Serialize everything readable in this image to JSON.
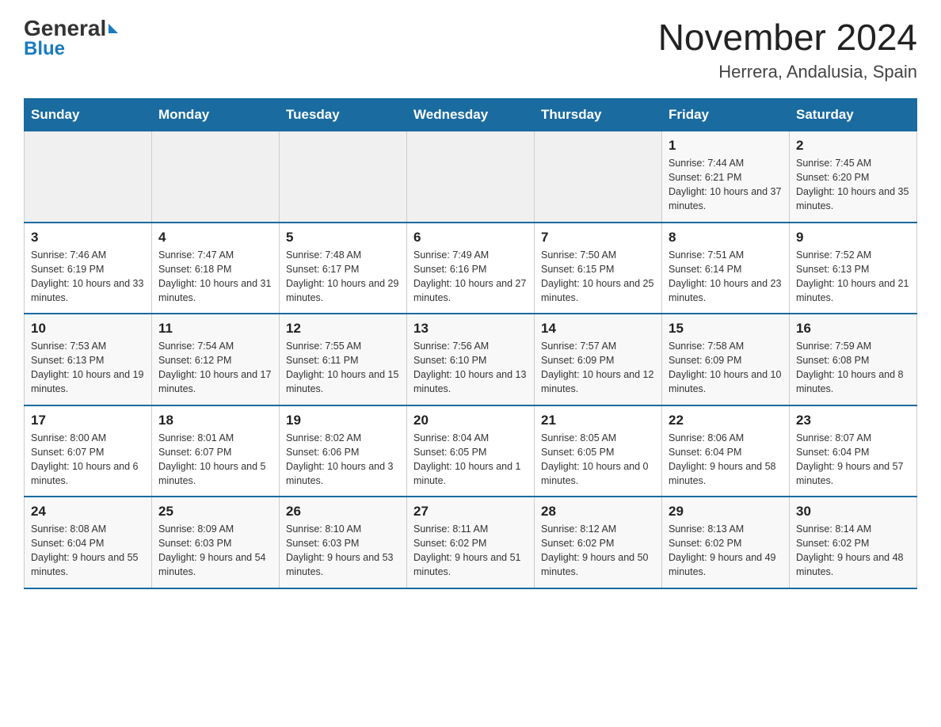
{
  "header": {
    "logo_general": "General",
    "logo_blue": "Blue",
    "month_year": "November 2024",
    "location": "Herrera, Andalusia, Spain"
  },
  "weekdays": [
    "Sunday",
    "Monday",
    "Tuesday",
    "Wednesday",
    "Thursday",
    "Friday",
    "Saturday"
  ],
  "weeks": [
    [
      {
        "day": "",
        "info": ""
      },
      {
        "day": "",
        "info": ""
      },
      {
        "day": "",
        "info": ""
      },
      {
        "day": "",
        "info": ""
      },
      {
        "day": "",
        "info": ""
      },
      {
        "day": "1",
        "info": "Sunrise: 7:44 AM\nSunset: 6:21 PM\nDaylight: 10 hours and 37 minutes."
      },
      {
        "day": "2",
        "info": "Sunrise: 7:45 AM\nSunset: 6:20 PM\nDaylight: 10 hours and 35 minutes."
      }
    ],
    [
      {
        "day": "3",
        "info": "Sunrise: 7:46 AM\nSunset: 6:19 PM\nDaylight: 10 hours and 33 minutes."
      },
      {
        "day": "4",
        "info": "Sunrise: 7:47 AM\nSunset: 6:18 PM\nDaylight: 10 hours and 31 minutes."
      },
      {
        "day": "5",
        "info": "Sunrise: 7:48 AM\nSunset: 6:17 PM\nDaylight: 10 hours and 29 minutes."
      },
      {
        "day": "6",
        "info": "Sunrise: 7:49 AM\nSunset: 6:16 PM\nDaylight: 10 hours and 27 minutes."
      },
      {
        "day": "7",
        "info": "Sunrise: 7:50 AM\nSunset: 6:15 PM\nDaylight: 10 hours and 25 minutes."
      },
      {
        "day": "8",
        "info": "Sunrise: 7:51 AM\nSunset: 6:14 PM\nDaylight: 10 hours and 23 minutes."
      },
      {
        "day": "9",
        "info": "Sunrise: 7:52 AM\nSunset: 6:13 PM\nDaylight: 10 hours and 21 minutes."
      }
    ],
    [
      {
        "day": "10",
        "info": "Sunrise: 7:53 AM\nSunset: 6:13 PM\nDaylight: 10 hours and 19 minutes."
      },
      {
        "day": "11",
        "info": "Sunrise: 7:54 AM\nSunset: 6:12 PM\nDaylight: 10 hours and 17 minutes."
      },
      {
        "day": "12",
        "info": "Sunrise: 7:55 AM\nSunset: 6:11 PM\nDaylight: 10 hours and 15 minutes."
      },
      {
        "day": "13",
        "info": "Sunrise: 7:56 AM\nSunset: 6:10 PM\nDaylight: 10 hours and 13 minutes."
      },
      {
        "day": "14",
        "info": "Sunrise: 7:57 AM\nSunset: 6:09 PM\nDaylight: 10 hours and 12 minutes."
      },
      {
        "day": "15",
        "info": "Sunrise: 7:58 AM\nSunset: 6:09 PM\nDaylight: 10 hours and 10 minutes."
      },
      {
        "day": "16",
        "info": "Sunrise: 7:59 AM\nSunset: 6:08 PM\nDaylight: 10 hours and 8 minutes."
      }
    ],
    [
      {
        "day": "17",
        "info": "Sunrise: 8:00 AM\nSunset: 6:07 PM\nDaylight: 10 hours and 6 minutes."
      },
      {
        "day": "18",
        "info": "Sunrise: 8:01 AM\nSunset: 6:07 PM\nDaylight: 10 hours and 5 minutes."
      },
      {
        "day": "19",
        "info": "Sunrise: 8:02 AM\nSunset: 6:06 PM\nDaylight: 10 hours and 3 minutes."
      },
      {
        "day": "20",
        "info": "Sunrise: 8:04 AM\nSunset: 6:05 PM\nDaylight: 10 hours and 1 minute."
      },
      {
        "day": "21",
        "info": "Sunrise: 8:05 AM\nSunset: 6:05 PM\nDaylight: 10 hours and 0 minutes."
      },
      {
        "day": "22",
        "info": "Sunrise: 8:06 AM\nSunset: 6:04 PM\nDaylight: 9 hours and 58 minutes."
      },
      {
        "day": "23",
        "info": "Sunrise: 8:07 AM\nSunset: 6:04 PM\nDaylight: 9 hours and 57 minutes."
      }
    ],
    [
      {
        "day": "24",
        "info": "Sunrise: 8:08 AM\nSunset: 6:04 PM\nDaylight: 9 hours and 55 minutes."
      },
      {
        "day": "25",
        "info": "Sunrise: 8:09 AM\nSunset: 6:03 PM\nDaylight: 9 hours and 54 minutes."
      },
      {
        "day": "26",
        "info": "Sunrise: 8:10 AM\nSunset: 6:03 PM\nDaylight: 9 hours and 53 minutes."
      },
      {
        "day": "27",
        "info": "Sunrise: 8:11 AM\nSunset: 6:02 PM\nDaylight: 9 hours and 51 minutes."
      },
      {
        "day": "28",
        "info": "Sunrise: 8:12 AM\nSunset: 6:02 PM\nDaylight: 9 hours and 50 minutes."
      },
      {
        "day": "29",
        "info": "Sunrise: 8:13 AM\nSunset: 6:02 PM\nDaylight: 9 hours and 49 minutes."
      },
      {
        "day": "30",
        "info": "Sunrise: 8:14 AM\nSunset: 6:02 PM\nDaylight: 9 hours and 48 minutes."
      }
    ]
  ]
}
